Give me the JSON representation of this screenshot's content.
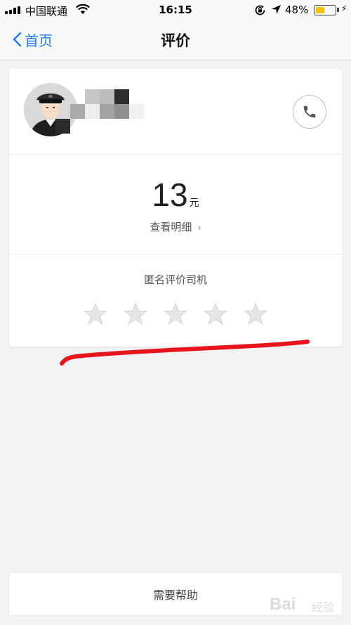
{
  "status_bar": {
    "carrier": "中国联通",
    "time": "16:15",
    "battery_percent": "48%",
    "battery_level": 0.48,
    "colors": {
      "battery_fill": "#f5c400"
    }
  },
  "nav": {
    "back_label": "首页",
    "title": "评价",
    "accent_color": "#1a7cf0"
  },
  "driver": {
    "avatar_icon": "driver-avatar-icon",
    "phone_icon": "phone-icon"
  },
  "fare": {
    "amount": "13",
    "unit": "元",
    "detail_label": "查看明细",
    "detail_chevron": "›"
  },
  "rating": {
    "label": "匿名评价司机",
    "max_stars": 5,
    "selected_stars": 0,
    "star_color": "#e6e6e6"
  },
  "help": {
    "label": "需要帮助"
  },
  "watermark": {
    "text": "Bai",
    "sub": "经验"
  }
}
